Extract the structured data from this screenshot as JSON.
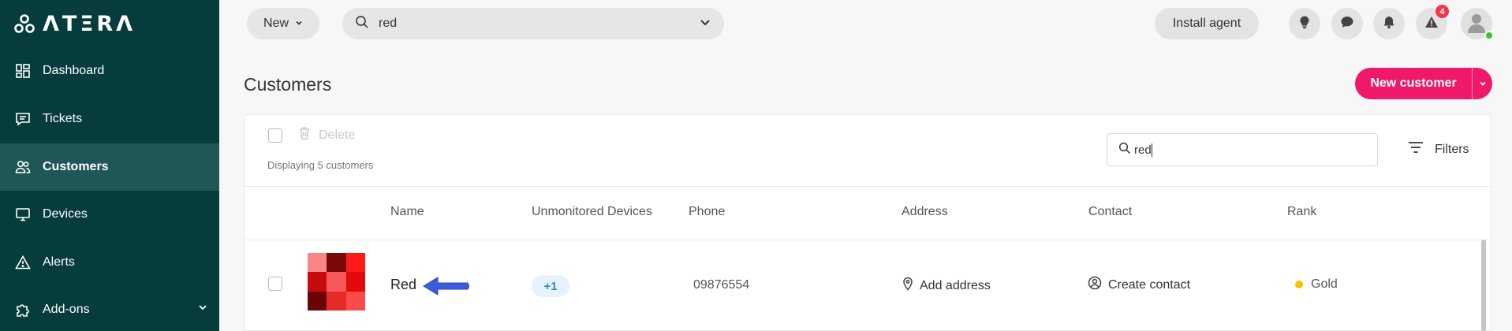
{
  "sidebar": {
    "logo_text": "ΛTΞRΛ",
    "items": [
      {
        "label": "Dashboard",
        "icon": "dashboard-icon"
      },
      {
        "label": "Tickets",
        "icon": "ticket-icon"
      },
      {
        "label": "Customers",
        "icon": "customers-icon",
        "active": true
      },
      {
        "label": "Devices",
        "icon": "monitor-icon"
      },
      {
        "label": "Alerts",
        "icon": "warning-icon"
      },
      {
        "label": "Add-ons",
        "icon": "puzzle-icon"
      }
    ]
  },
  "topbar": {
    "new_label": "New",
    "search_value": "red",
    "install_label": "Install agent",
    "alerts_badge": "4"
  },
  "page": {
    "title": "Customers",
    "new_customer_label": "New customer"
  },
  "toolbar": {
    "delete_label": "Delete",
    "displaying_text": "Displaying 5 customers",
    "search_value": "red",
    "filters_label": "Filters"
  },
  "table": {
    "columns": [
      "Name",
      "Unmonitored Devices",
      "Phone",
      "Address",
      "Contact",
      "Rank"
    ],
    "rows": [
      {
        "name": "Red",
        "unmonitored": "+1",
        "phone": "09876554",
        "address": "Add address",
        "contact": "Create contact",
        "rank": "Gold"
      }
    ]
  },
  "colors": {
    "sidebar_bg": "#063c3c",
    "sidebar_active": "#1f5656",
    "accent_pink": "#f0186a",
    "badge_red": "#f4364c",
    "gold": "#f5c400",
    "pill_blue": "#2a8ad0",
    "pointer_blue": "#3b5bdb",
    "thumb_colors": [
      "#f98585",
      "#7a0a0a",
      "#ff1a1a",
      "#c80a0a",
      "#f95858",
      "#e20a0a",
      "#6b0505",
      "#e62b2b",
      "#fb4a4a"
    ]
  }
}
